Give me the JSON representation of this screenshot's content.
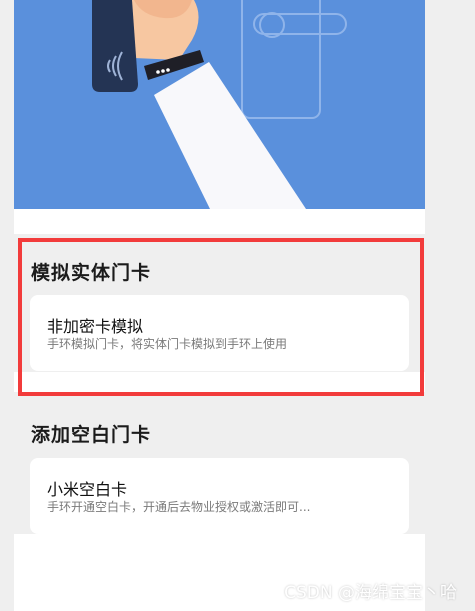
{
  "sections": [
    {
      "title": "模拟实体门卡",
      "card": {
        "title": "非加密卡模拟",
        "subtitle": "手环模拟门卡，将实体门卡模拟到手环上使用"
      }
    },
    {
      "title": "添加空白门卡",
      "card": {
        "title": "小米空白卡",
        "subtitle": "手环开通空白卡，开通后去物业授权或激活即可..."
      }
    }
  ],
  "watermark": "CSDN @海绵宝宝丶哈",
  "colors": {
    "hero_background": "#5a90dc",
    "highlight_border": "#f23b3b",
    "page_background": "#efefef",
    "card_background": "#ffffff"
  }
}
